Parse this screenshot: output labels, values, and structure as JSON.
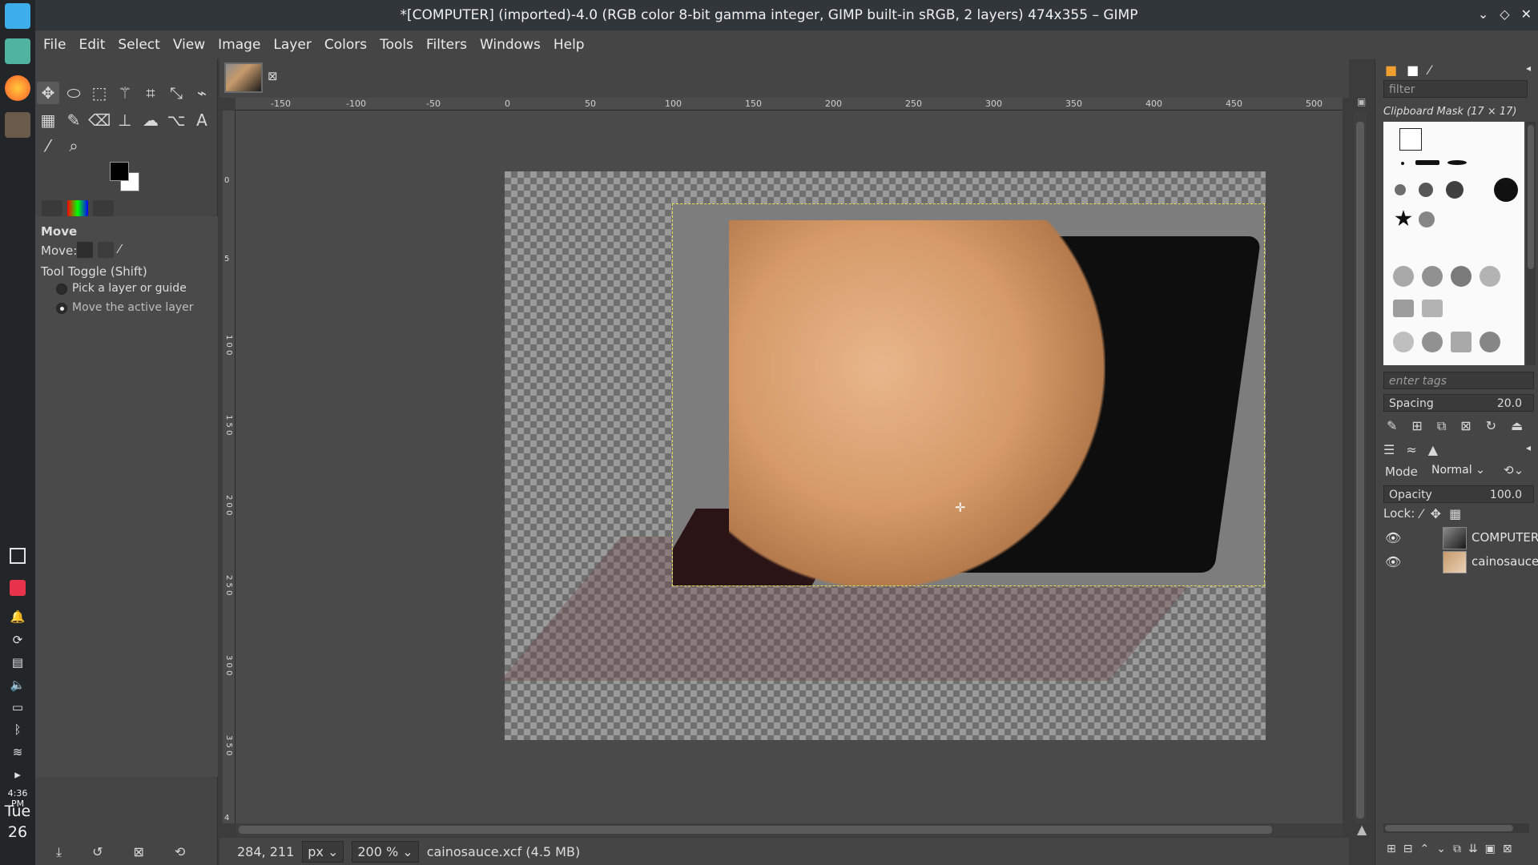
{
  "window": {
    "title": "*[COMPUTER] (imported)-4.0 (RGB color 8-bit gamma integer, GIMP built-in sRGB, 2 layers) 474x355 – GIMP",
    "controls": [
      "minimize-icon",
      "maximize-icon",
      "close-icon"
    ]
  },
  "taskbar": {
    "apps": [
      "files-icon",
      "firefox-icon",
      "gimp-icon"
    ],
    "tray": [
      "rectangle-icon",
      "bag-icon",
      "notifications-icon",
      "updates-icon",
      "clipboard-icon",
      "volume-icon",
      "battery-icon",
      "bluetooth-icon",
      "wifi-icon",
      "expand-icon"
    ],
    "clock_time": "4:36 PM",
    "clock_day": "Tue",
    "clock_date": "26"
  },
  "menu": {
    "items": [
      "File",
      "Edit",
      "Select",
      "View",
      "Image",
      "Layer",
      "Colors",
      "Tools",
      "Filters",
      "Windows",
      "Help"
    ]
  },
  "toolbox": {
    "tools": [
      "move-icon",
      "ellipse-select-icon",
      "free-select-icon",
      "fuzzy-select-icon",
      "crop-icon",
      "scale-icon",
      "warp-icon",
      "gradient-icon",
      "paintbrush-icon",
      "eraser-icon",
      "clone-icon",
      "smudge-icon",
      "paths-icon",
      "text-icon",
      "color-picker-icon",
      "zoom-icon"
    ],
    "options": {
      "title": "Move",
      "move_label": "Move:",
      "toggle_label": "Tool Toggle  (Shift)",
      "radio_1": "Pick a layer or guide",
      "radio_2": "Move the active layer",
      "selected": 2
    }
  },
  "rulers": {
    "h_ticks": [
      "-150",
      "-100",
      "-50",
      "0",
      "50",
      "100",
      "150",
      "200",
      "250",
      "300",
      "350",
      "400",
      "450",
      "500"
    ],
    "v_ticks": [
      "0",
      "5",
      "1 0 0",
      "1 5 0",
      "2 0 0",
      "2 5 0",
      "3 0 0",
      "3 5 0",
      "4"
    ]
  },
  "status": {
    "coords": "284, 211",
    "unit": "px",
    "zoom": "200 %",
    "file": "cainosauce.xcf (4.5 MB)"
  },
  "brushes": {
    "filter_placeholder": "filter",
    "selected_brush": "Clipboard Mask (17 × 17)",
    "tags_placeholder": "enter tags",
    "spacing_label": "Spacing",
    "spacing_value": "20.0"
  },
  "layers": {
    "mode_label": "Mode",
    "mode_value": "Normal",
    "opacity_label": "Opacity",
    "opacity_value": "100.0",
    "lock_label": "Lock:",
    "items": [
      {
        "name": "COMPUTER"
      },
      {
        "name": "cainosauce"
      }
    ]
  },
  "colors": {
    "accent": "#e6e050",
    "panel": "#454545"
  }
}
